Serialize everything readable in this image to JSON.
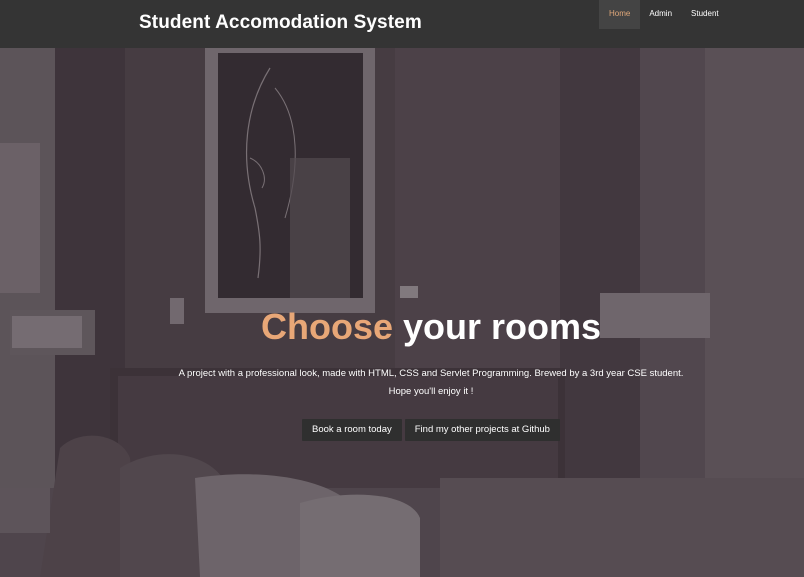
{
  "header": {
    "brand": "Student Accomodation System",
    "nav": [
      {
        "label": "Home",
        "active": true
      },
      {
        "label": "Admin",
        "active": false
      },
      {
        "label": "Student",
        "active": false
      }
    ]
  },
  "hero": {
    "headline_accent": "Choose",
    "headline_rest": " your rooms",
    "tagline_line1": "A project with a professional look, made with HTML, CSS and Servlet Programming. Brewed by a 3rd year CSE student.",
    "tagline_line2": "Hope you'll enjoy it !",
    "primary_button": "Book a room today",
    "secondary_button": "Find my other projects at Github"
  },
  "colors": {
    "topbar": "#343434",
    "accent": "#e8a777",
    "button": "#2f2f2f"
  }
}
